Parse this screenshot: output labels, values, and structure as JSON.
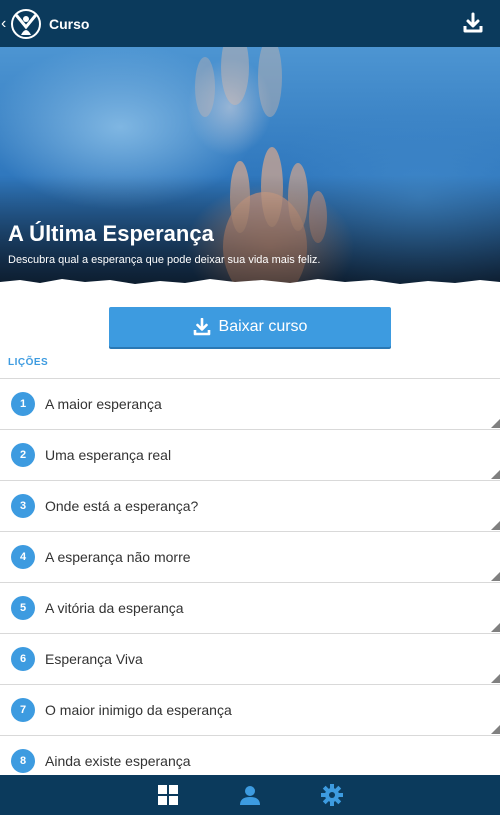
{
  "header": {
    "title": "Curso",
    "back_icon": "chevron-left-icon",
    "logo_icon": "app-logo-icon",
    "download_icon": "download-icon"
  },
  "hero": {
    "title": "A Última Esperança",
    "subtitle": "Descubra qual a esperança que pode deixar sua vida mais feliz."
  },
  "download_button": {
    "label": "Baixar curso",
    "icon": "download-icon"
  },
  "lessons_section": {
    "title": "LIÇÕES",
    "items": [
      {
        "number": "1",
        "label": "A maior esperança"
      },
      {
        "number": "2",
        "label": "Uma esperança real"
      },
      {
        "number": "3",
        "label": "Onde está a esperança?"
      },
      {
        "number": "4",
        "label": "A esperança não morre"
      },
      {
        "number": "5",
        "label": "A vitória da esperança"
      },
      {
        "number": "6",
        "label": "Esperança Viva"
      },
      {
        "number": "7",
        "label": "O maior inimigo da esperança"
      },
      {
        "number": "8",
        "label": "Ainda existe esperança"
      }
    ]
  },
  "bottom_nav": {
    "items": [
      "grid-icon",
      "user-icon",
      "gear-icon"
    ]
  },
  "colors": {
    "header_bg": "#0b3a5c",
    "accent": "#3d9be0",
    "text": "#333333",
    "divider": "#d9d9d9"
  }
}
